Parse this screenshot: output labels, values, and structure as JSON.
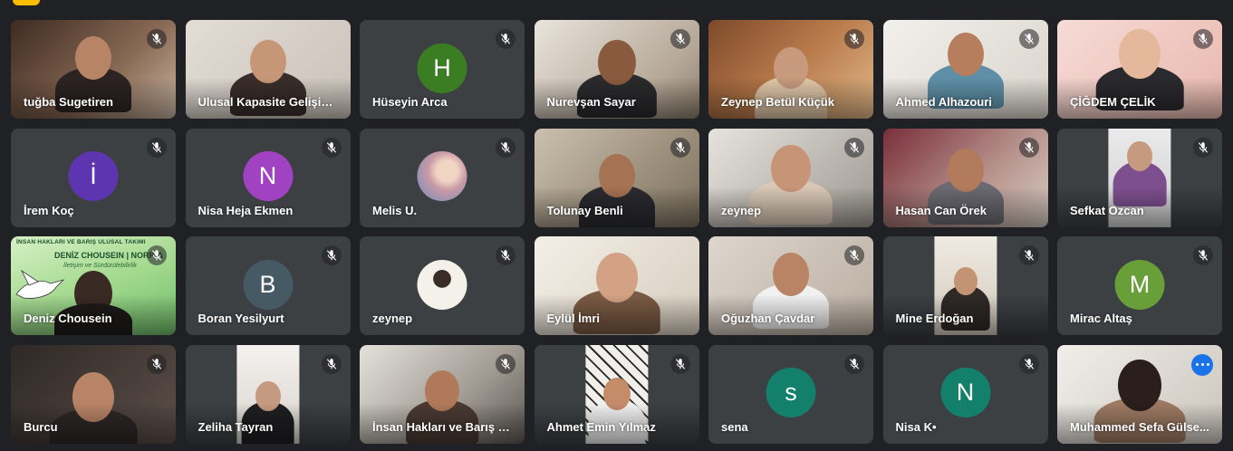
{
  "meeting": {
    "participants": [
      {
        "name": "tuğba Sugetiren",
        "type": "video",
        "muted": true
      },
      {
        "name": "Ulusal Kapasite Gelişimi...",
        "type": "video",
        "muted": false
      },
      {
        "name": "Hüseyin Arca",
        "type": "avatar",
        "initial": "H",
        "avatar_color": "#3b7d23",
        "muted": true
      },
      {
        "name": "Nurevşan Sayar",
        "type": "video",
        "muted": true
      },
      {
        "name": "Zeynep Betül Küçük",
        "type": "video",
        "muted": true
      },
      {
        "name": "Ahmed Alhazouri",
        "type": "video",
        "muted": true
      },
      {
        "name": "ÇİĞDEM ÇELİK",
        "type": "video",
        "muted": true
      },
      {
        "name": "İrem Koç",
        "type": "avatar",
        "initial": "İ",
        "avatar_color": "#5e35b1",
        "muted": true
      },
      {
        "name": "Nisa Heja Ekmen",
        "type": "avatar",
        "initial": "N",
        "avatar_color": "#a142c2",
        "muted": true
      },
      {
        "name": "Melis U.",
        "type": "photo-avatar",
        "muted": true
      },
      {
        "name": "Tolunay Benli",
        "type": "video",
        "muted": true
      },
      {
        "name": "zeynep",
        "type": "video",
        "muted": true
      },
      {
        "name": "Hasan Can Örek",
        "type": "video",
        "muted": true
      },
      {
        "name": "Sefkat Ozcan",
        "type": "video",
        "muted": true
      },
      {
        "name": "Deniz Chousein",
        "type": "banner",
        "muted": true
      },
      {
        "name": "Boran Yesilyurt",
        "type": "avatar",
        "initial": "B",
        "avatar_color": "#455a64",
        "muted": true
      },
      {
        "name": "zeynep",
        "type": "photo-avatar",
        "muted": true
      },
      {
        "name": "Eylül İmri",
        "type": "video",
        "muted": false
      },
      {
        "name": "Oğuzhan Çavdar",
        "type": "video",
        "muted": true
      },
      {
        "name": "Mine Erdoğan",
        "type": "video",
        "muted": true
      },
      {
        "name": "Mirac Altaş",
        "type": "avatar",
        "initial": "M",
        "avatar_color": "#689f38",
        "muted": true
      },
      {
        "name": "Burcu",
        "type": "video",
        "muted": true
      },
      {
        "name": "Zeliha Tayran",
        "type": "video",
        "muted": true
      },
      {
        "name": "İnsan Hakları ve Barış Ta...",
        "type": "video",
        "muted": true
      },
      {
        "name": "Ahmet Emin Yılmaz",
        "type": "video",
        "muted": true
      },
      {
        "name": "sena",
        "type": "avatar",
        "initial": "s",
        "avatar_color": "#12806a",
        "muted": true
      },
      {
        "name": "Nisa K•",
        "type": "avatar",
        "initial": "N",
        "avatar_color": "#12806a",
        "muted": true
      },
      {
        "name": "Muhammed Sefa Gülse...",
        "type": "video",
        "muted": false,
        "active_speaker": true
      }
    ]
  },
  "banner": {
    "title": "İNSAN HAKLARI VE BARIŞ ULUSAL TAKIMI",
    "name": "DENİZ CHOUSEIN | NORP-A",
    "subtitle": "İletişim ve Sürdürülebilirlik"
  },
  "colors": {
    "page_bg": "#202124",
    "tile_bg": "#3c4043",
    "active_outline": "#8ab4f8",
    "accent_yellow": "#fbbc04",
    "more_button": "#1a73e8"
  },
  "icons": {
    "mic_off": "mic-off-icon",
    "more": "more-options-icon"
  }
}
